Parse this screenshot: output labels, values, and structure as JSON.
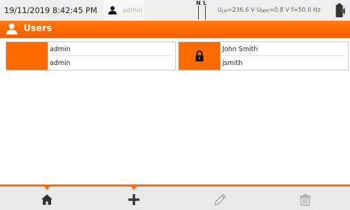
{
  "status": {
    "datetime": "19/11/2019 8:42:45 PM",
    "user": "admin",
    "phase_labels": [
      "N",
      "L"
    ],
    "measurement_parts": {
      "uln_label": "U",
      "uln_sub": "LN",
      "uln_value": "=236.6 V ",
      "unpe_label": "U",
      "unpe_sub": "NPE",
      "unpe_value": "=0.8 V f=50.0 Hz"
    }
  },
  "title": {
    "text": "Users",
    "icon": "user-icon"
  },
  "users": [
    {
      "line1": "admin",
      "line2": "admin",
      "locked": false
    },
    {
      "line1": "John Smith",
      "line2": "jsmith",
      "locked": true
    }
  ],
  "toolbar": {
    "buttons": [
      {
        "name": "home",
        "icon": "home-icon",
        "active": true
      },
      {
        "name": "add",
        "icon": "plus-icon",
        "active": true
      },
      {
        "name": "edit",
        "icon": "pencil-icon",
        "active": false
      },
      {
        "name": "delete",
        "icon": "trash-icon",
        "active": false
      }
    ]
  },
  "colors": {
    "accent": "#ff6a00",
    "status_bg": "#efefef",
    "toolbar_bg": "#e9e9e9",
    "icon_dark": "#333333",
    "icon_disabled": "#b0b0b0"
  }
}
